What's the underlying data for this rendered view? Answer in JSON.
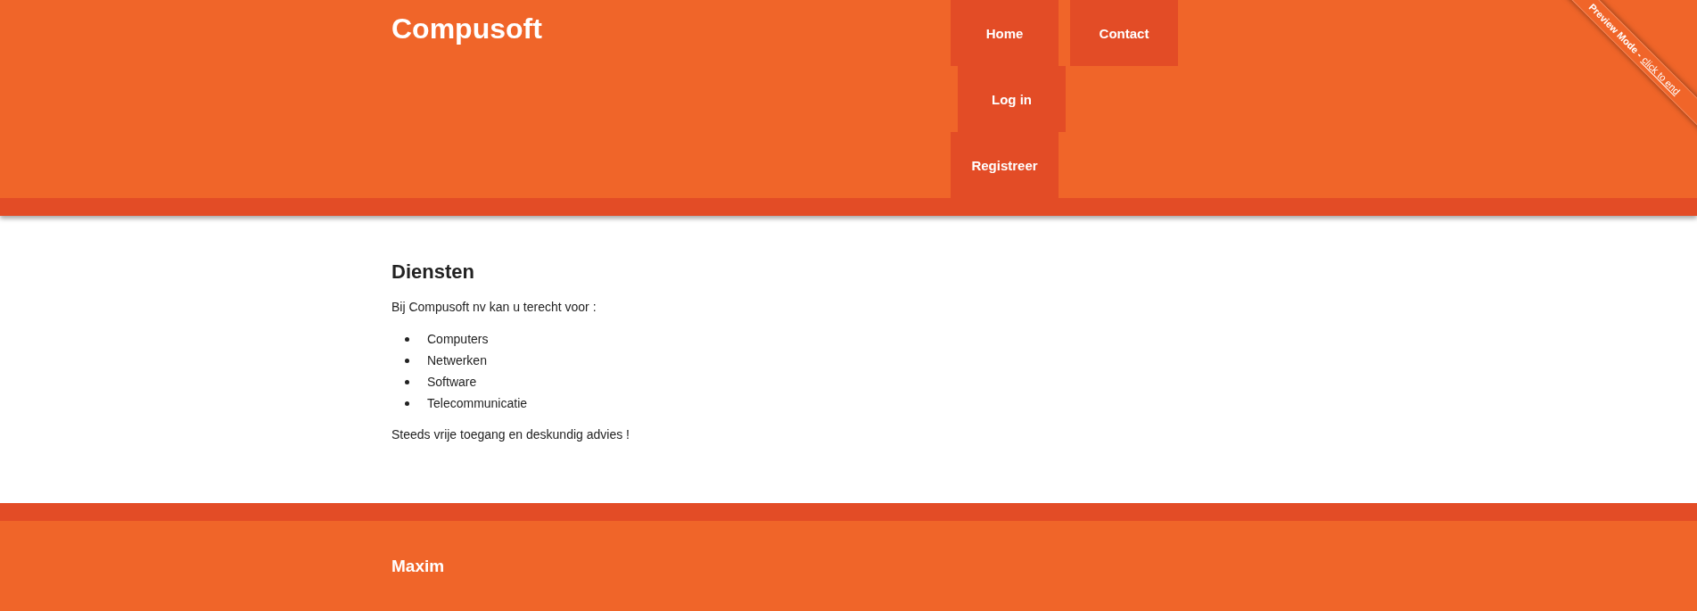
{
  "header": {
    "title": "Compusoft",
    "nav": [
      {
        "label": "Home"
      },
      {
        "label": "Contact"
      },
      {
        "label": "Log in"
      },
      {
        "label": "Registreer"
      }
    ]
  },
  "ribbon": {
    "text": "Preview Mode -",
    "link": "click to end"
  },
  "content": {
    "heading": "Diensten",
    "intro": "Bij Compusoft nv kan u terecht voor :",
    "items": [
      "Computers",
      "Netwerken",
      "Software",
      "Telecommunicatie"
    ],
    "closing": "Steeds vrije toegang en deskundig advies !"
  },
  "footer": {
    "name": "Maxim"
  }
}
